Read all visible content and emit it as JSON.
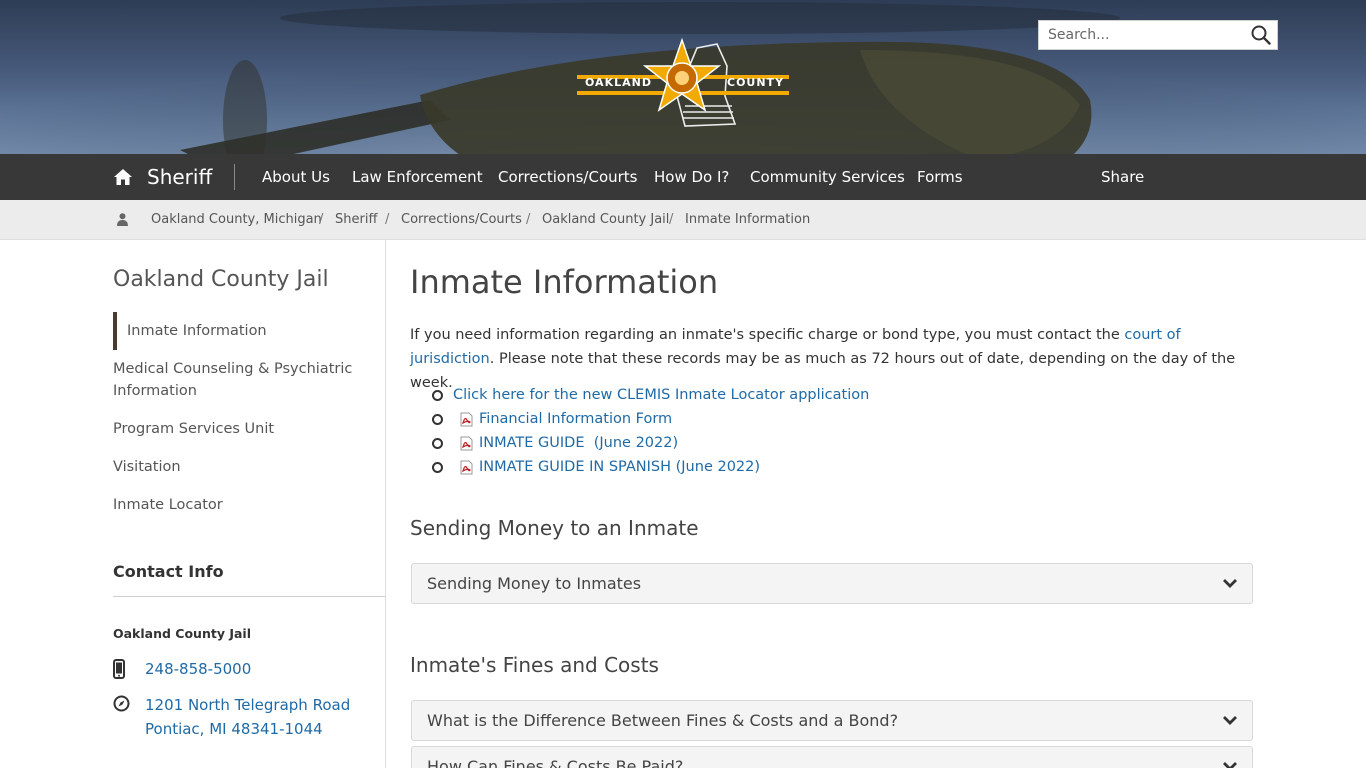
{
  "search": {
    "placeholder": "Search..."
  },
  "logo": {
    "text_left": "OAKLAND",
    "text_right": "COUNTY"
  },
  "nav": {
    "home_label": "Sheriff",
    "items": [
      "About Us",
      "Law Enforcement",
      "Corrections/Courts",
      "How Do I?",
      "Community Services",
      "Forms"
    ],
    "share_label": "Share"
  },
  "breadcrumb": [
    "Oakland County, Michigan",
    "Sheriff",
    "Corrections/Courts",
    "Oakland County Jail",
    "Inmate Information"
  ],
  "sidebar": {
    "title": "Oakland County Jail",
    "items": [
      "Inmate Information",
      "Medical Counseling & Psychiatric Information",
      "Program Services Unit",
      "Visitation",
      "Inmate Locator"
    ],
    "contact_title": "Contact Info",
    "org": "Oakland County Jail",
    "phone": "248-858-5000",
    "address_line1": "1201 North Telegraph Road",
    "address_line2": "Pontiac, MI 48341-1044"
  },
  "main": {
    "title": "Inmate Information",
    "intro_before": "If you need information regarding an inmate's specific charge or bond type, you must contact the ",
    "intro_link": "court of jurisdiction",
    "intro_after": ". Please note that these records may be as much as 72 hours out of date, depending on the day of the week.",
    "links": [
      "Click here for the new CLEMIS Inmate Locator application",
      "Financial Information Form",
      "INMATE GUIDE  (June 2022)",
      "INMATE GUIDE IN SPANISH (June 2022)"
    ],
    "section1_title": "Sending Money to an Inmate",
    "section1_accordion": "Sending Money to Inmates",
    "section2_title": "Inmate's Fines and Costs",
    "section2_accordions": [
      "What is the Difference Between Fines & Costs and a Bond?",
      "How Can Fines & Costs Be Paid?"
    ]
  },
  "colors": {
    "link": "#1f6aa6",
    "nav_bg": "#1c1c1c",
    "accent_gold": "#f2a900"
  }
}
